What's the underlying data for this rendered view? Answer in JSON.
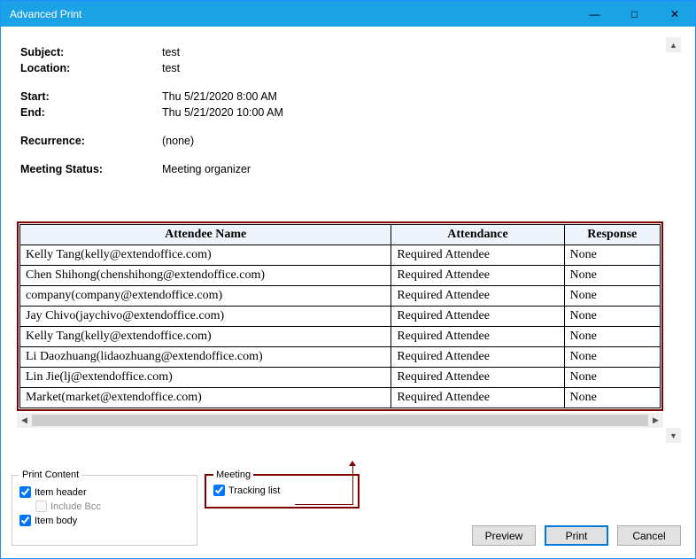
{
  "window": {
    "title": "Advanced Print"
  },
  "details": {
    "subject_label": "Subject:",
    "subject_value": "test",
    "location_label": "Location:",
    "location_value": "test",
    "start_label": "Start:",
    "start_value": "Thu 5/21/2020 8:00 AM",
    "end_label": "End:",
    "end_value": "Thu 5/21/2020 10:00 AM",
    "recurrence_label": "Recurrence:",
    "recurrence_value": "(none)",
    "status_label": "Meeting Status:",
    "status_value": "Meeting organizer"
  },
  "tracking": {
    "headers": {
      "name": "Attendee Name",
      "attendance": "Attendance",
      "response": "Response"
    },
    "rows": [
      {
        "name": "Kelly Tang(kelly@extendoffice.com)",
        "attendance": "Required Attendee",
        "response": "None"
      },
      {
        "name": "Chen Shihong(chenshihong@extendoffice.com)",
        "attendance": "Required Attendee",
        "response": "None"
      },
      {
        "name": "company(company@extendoffice.com)",
        "attendance": "Required Attendee",
        "response": "None"
      },
      {
        "name": "Jay Chivo(jaychivo@extendoffice.com)",
        "attendance": "Required Attendee",
        "response": "None"
      },
      {
        "name": "Kelly Tang(kelly@extendoffice.com)",
        "attendance": "Required Attendee",
        "response": "None"
      },
      {
        "name": "Li Daozhuang(lidaozhuang@extendoffice.com)",
        "attendance": "Required Attendee",
        "response": "None"
      },
      {
        "name": "Lin Jie(lj@extendoffice.com)",
        "attendance": "Required Attendee",
        "response": "None"
      },
      {
        "name": "Market(market@extendoffice.com)",
        "attendance": "Required Attendee",
        "response": "None"
      }
    ]
  },
  "footer": {
    "print_content_legend": "Print Content",
    "item_header": "Item header",
    "include_bcc": "Include Bcc",
    "item_body": "Item body",
    "meeting_legend": "Meeting",
    "tracking_list": "Tracking list",
    "preview": "Preview",
    "print": "Print",
    "cancel": "Cancel"
  }
}
